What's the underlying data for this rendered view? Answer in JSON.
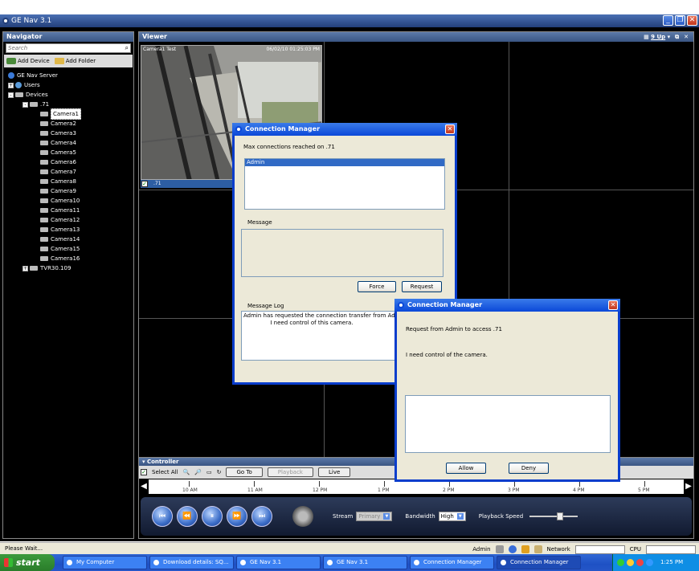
{
  "window": {
    "title": "GE Nav 3.1"
  },
  "navigator": {
    "header": "Navigator",
    "search_placeholder": "Search",
    "add_device": "Add Device",
    "add_folder": "Add Folder",
    "tree": {
      "server": "GE Nav Server",
      "users": "Users",
      "devices": "Devices",
      "device_group": ".71",
      "cameras": [
        "Camera1",
        "Camera2",
        "Camera3",
        "Camera4",
        "Camera5",
        "Camera6",
        "Camera7",
        "Camera8",
        "Camera9",
        "Camera10",
        "Camera11",
        "Camera12",
        "Camera13",
        "Camera14",
        "Camera15",
        "Camera16"
      ],
      "recorder": "TVR30.109"
    }
  },
  "viewer": {
    "header": "Viewer",
    "layout_label": "9 Up",
    "tile": {
      "label": "Camera1 Test",
      "timestamp": "06/02/10 01:25:03 PM",
      "footer": ".71"
    }
  },
  "controller": {
    "header": "Controller",
    "select_all": "Select All",
    "goto_label": "Go To",
    "playback_label": "Playback",
    "live_label": "Live",
    "timeline_ticks": [
      "10 AM",
      "11 AM",
      "12 PM",
      "1 PM",
      "2 PM",
      "3 PM",
      "4 PM",
      "5 PM"
    ],
    "stream_label": "Stream",
    "stream_value": "Primary",
    "bandwidth_label": "Bandwidth",
    "bandwidth_value": "High",
    "speed_label": "Playback Speed",
    "speed_level": 0.65
  },
  "conn_dialog": {
    "title": "Connection Manager",
    "max_text": "Max connections reached on .71",
    "list_items": [
      "Admin"
    ],
    "message_label": "Message",
    "force_label": "Force",
    "request_label": "Request",
    "log_label": "Message Log",
    "log_text": "Admin has requested the connection transfer from Admin.\n               I need control of this camera."
  },
  "request_dialog": {
    "title": "Connection Manager",
    "request_text": "Request from Admin to access .71",
    "need_text": "I need control of the camera.",
    "allow_label": "Allow",
    "deny_label": "Deny"
  },
  "statusbar": {
    "left_text": "Please Wait...",
    "user": "Admin",
    "network_label": "Network",
    "cpu_label": "CPU"
  },
  "taskbar": {
    "start_label": "start",
    "items": [
      "My Computer",
      "Download details: SQ...",
      "GE Nav 3.1",
      "GE Nav 3.1",
      "Connection Manager",
      "Connection Manager"
    ],
    "clock": "1:25 PM"
  }
}
